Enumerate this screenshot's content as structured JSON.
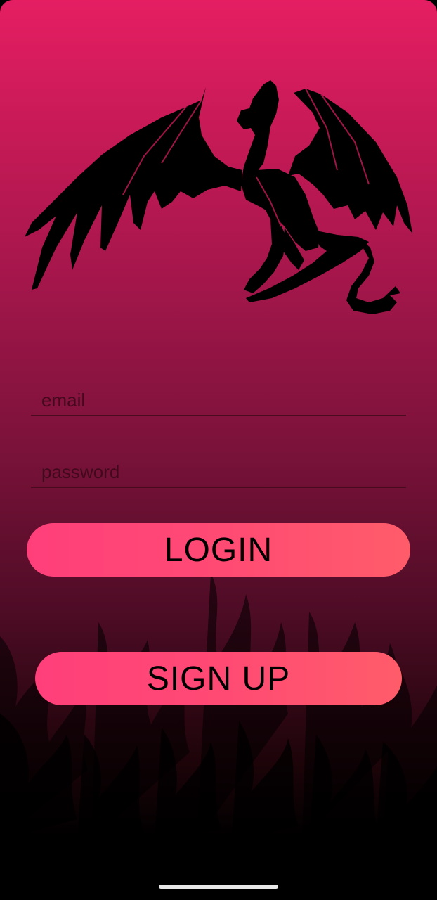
{
  "login_form": {
    "email_placeholder": "email",
    "password_placeholder": "password",
    "login_label": "LOGIN",
    "signup_label": "SIGN UP"
  },
  "decorations": {
    "hero_icon": "dragon-icon",
    "background_icon": "flames-icon"
  },
  "colors": {
    "gradient_top": "#e51e62",
    "gradient_bottom": "#000000",
    "button_left": "#ff3f7a",
    "button_right": "#ff5c6a",
    "text": "#000000"
  }
}
